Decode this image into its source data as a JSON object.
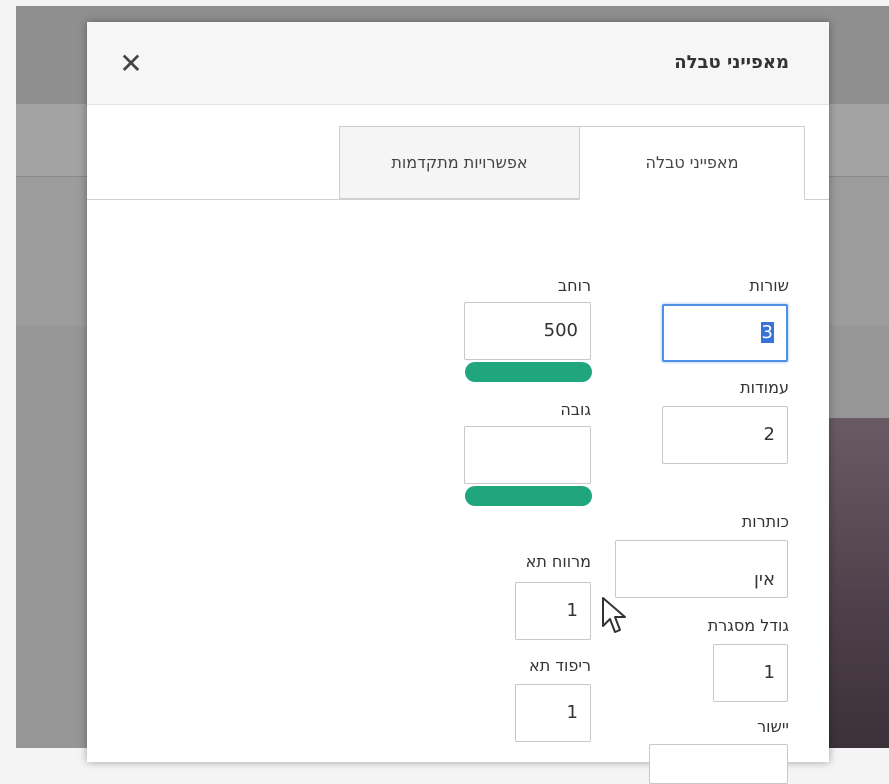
{
  "dialog": {
    "title": "מאפייני טבלה",
    "close_label": "✕"
  },
  "tabs": [
    {
      "label": "מאפייני טבלה",
      "active": true
    },
    {
      "label": "אפשרויות מתקדמות",
      "active": false
    }
  ],
  "fields": {
    "rows": {
      "label": "שורות",
      "value": "3"
    },
    "columns": {
      "label": "עמודות",
      "value": "2"
    },
    "headers": {
      "label": "כותרות",
      "value": "אין"
    },
    "border_size": {
      "label": "גודל מסגרת",
      "value": "1"
    },
    "alignment": {
      "label": "יישור"
    },
    "width": {
      "label": "רוחב",
      "value": "500"
    },
    "height": {
      "label": "גובה",
      "value": ""
    },
    "cell_spacing": {
      "label": "מרווח תא",
      "value": "1"
    },
    "cell_padding": {
      "label": "ריפוד תא",
      "value": "1"
    }
  },
  "colors": {
    "accent_green": "#20a67c",
    "focus_blue": "#4f8fe6"
  }
}
